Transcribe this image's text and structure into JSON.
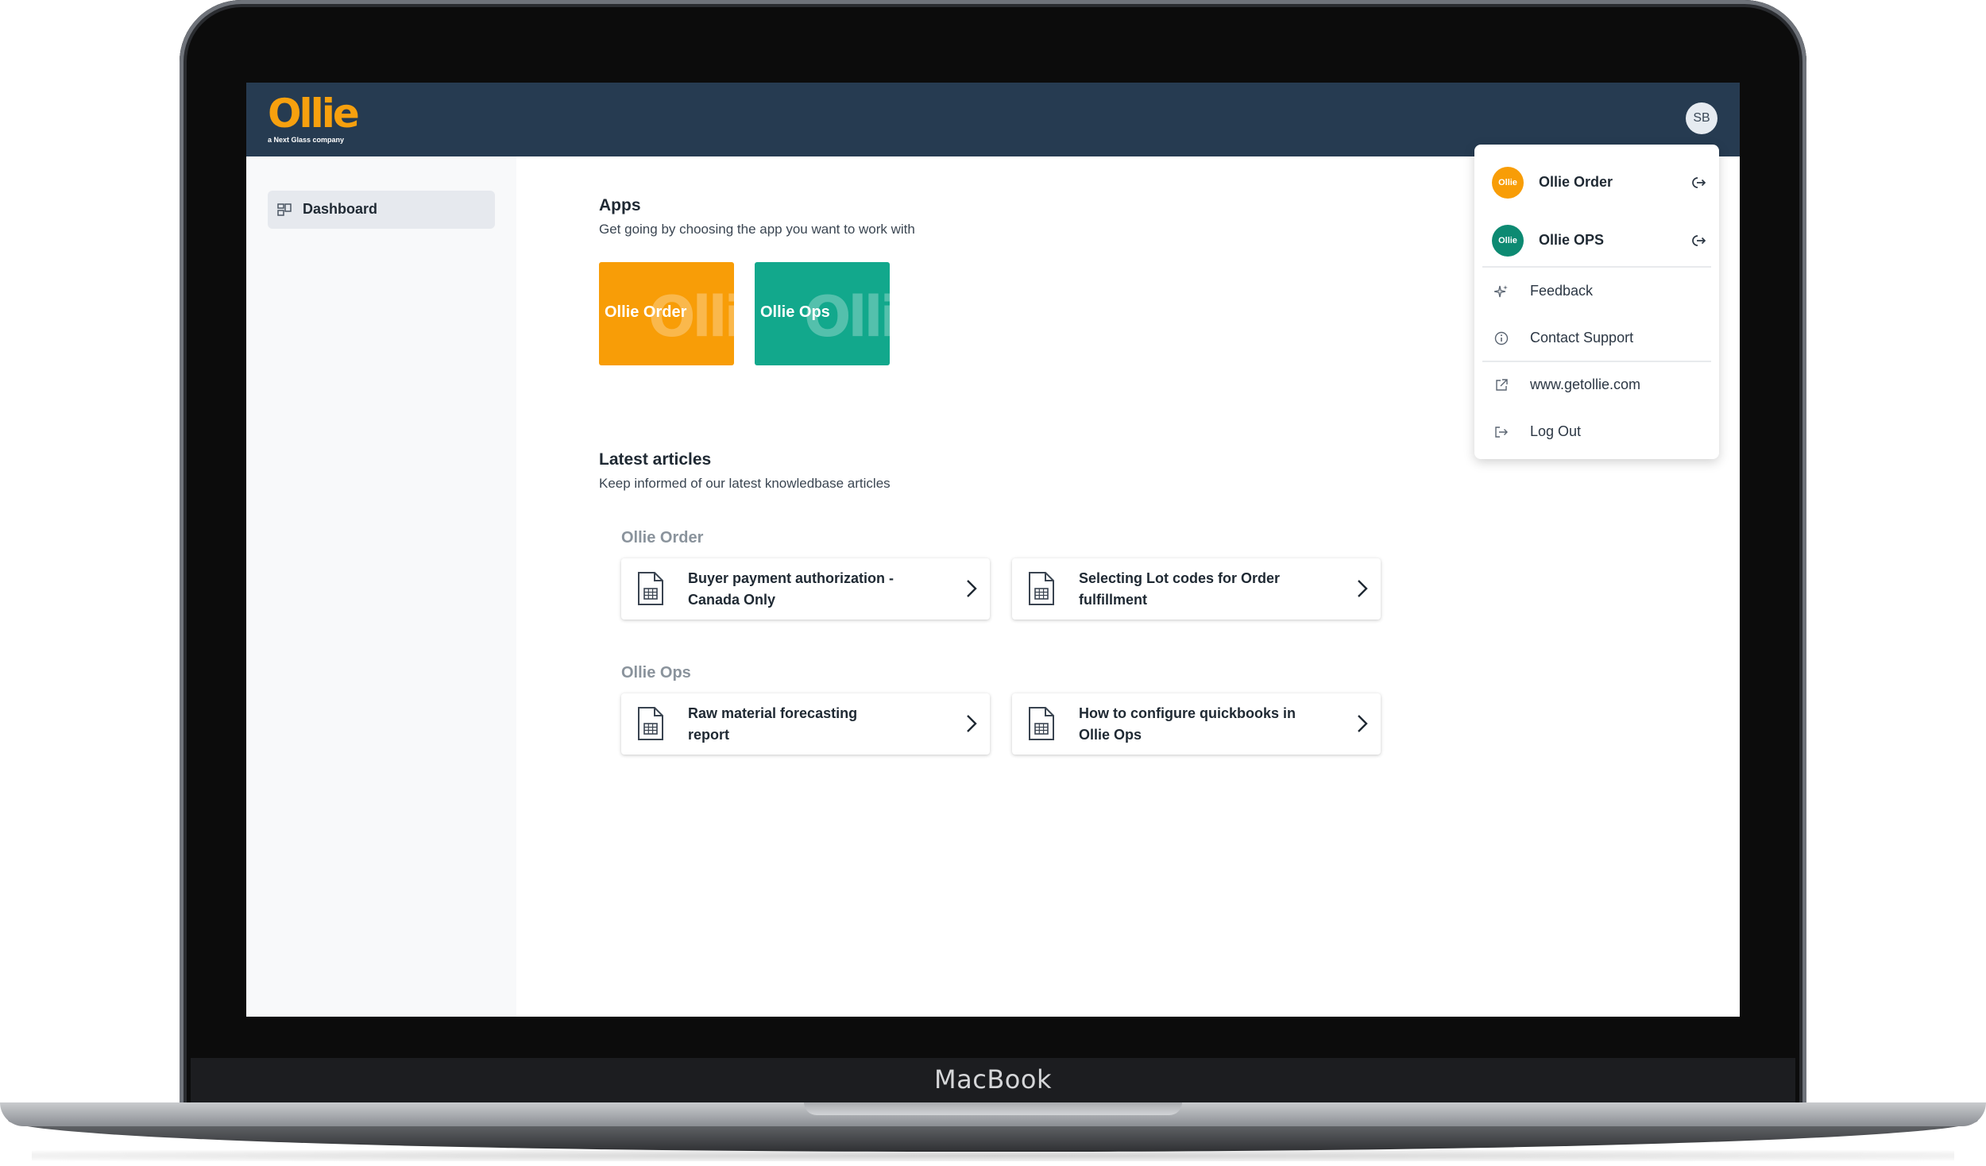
{
  "device": {
    "brand_label": "MacBook"
  },
  "header": {
    "logo_text": "Ollie",
    "logo_subtext": "a Next Glass company",
    "avatar_initials": "SB"
  },
  "sidebar": {
    "items": [
      {
        "label": "Dashboard",
        "icon": "dashboard-icon",
        "active": true
      }
    ]
  },
  "apps_section": {
    "title": "Apps",
    "subtitle": "Get going by choosing the app you want to work with",
    "apps": [
      {
        "label": "Ollie Order",
        "watermark": "Ollie",
        "color": "#f89d07"
      },
      {
        "label": "Ollie Ops",
        "watermark": "Ollie",
        "color": "#12a88c"
      }
    ]
  },
  "articles_section": {
    "title": "Latest articles",
    "subtitle": "Keep informed of our latest knowledbase articles",
    "groups": [
      {
        "name": "Ollie Order",
        "articles": [
          {
            "title": "Buyer payment authorization - Canada Only"
          },
          {
            "title": "Selecting Lot codes for Order fulfillment"
          }
        ]
      },
      {
        "name": "Ollie Ops",
        "articles": [
          {
            "title": "Raw material forecasting report"
          },
          {
            "title": "How to configure quickbooks in Ollie Ops"
          }
        ]
      }
    ]
  },
  "user_menu": {
    "apps": [
      {
        "label": "Ollie Order",
        "icon_text": "Ollie",
        "color": "#f89d07"
      },
      {
        "label": "Ollie OPS",
        "icon_text": "Ollie",
        "color": "#0d8a72"
      }
    ],
    "links": [
      {
        "label": "Feedback",
        "icon": "sparkle-icon"
      },
      {
        "label": "Contact Support",
        "icon": "info-icon"
      },
      {
        "label": "www.getollie.com",
        "icon": "external-link-icon"
      },
      {
        "label": "Log Out",
        "icon": "logout-icon"
      }
    ]
  },
  "colors": {
    "header_bg": "#263b51",
    "brand_orange": "#f7a00e",
    "brand_green": "#12a88c"
  }
}
